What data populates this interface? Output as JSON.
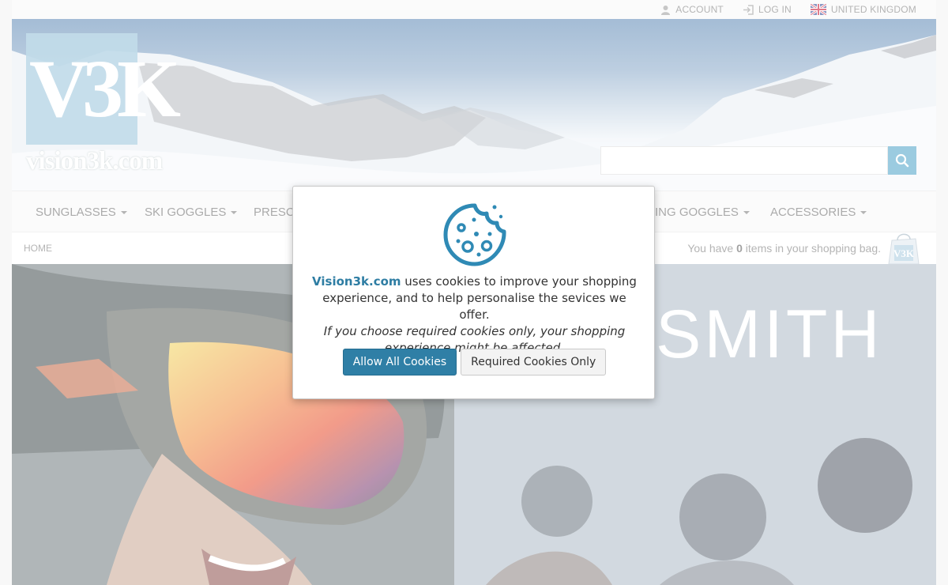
{
  "topbar": {
    "account_label": "ACCOUNT",
    "login_label": "LOG IN",
    "region_label": "UNITED KINGDOM"
  },
  "header": {
    "logo_mark": "V3K",
    "logo_text": "vision3k.com",
    "search_placeholder": ""
  },
  "nav": {
    "items": [
      {
        "label": "SUNGLASSES"
      },
      {
        "label": "SKI GOGGLES"
      },
      {
        "label": "PRESCR"
      },
      {
        "label": "ING GOGGLES"
      },
      {
        "label": "ACCESSORIES"
      }
    ]
  },
  "breadcrumb": {
    "home": "HOME"
  },
  "bag": {
    "prefix": "You have",
    "count": "0",
    "suffix": "items in your shopping bag."
  },
  "hero": {
    "brand_text": "SMITH"
  },
  "cookie_modal": {
    "site_name": "Vision3k.com",
    "message": " uses cookies to improve your shopping experience, and to help personalise the sevices we offer.",
    "note": "If you choose required cookies only, your shopping experience might be affected.",
    "allow_label": "Allow All Cookies",
    "required_label": "Required Cookies Only"
  },
  "colors": {
    "accent": "#2f7fa6",
    "search_button": "#4aa0c7",
    "logo_box": "#8fbfd8"
  }
}
